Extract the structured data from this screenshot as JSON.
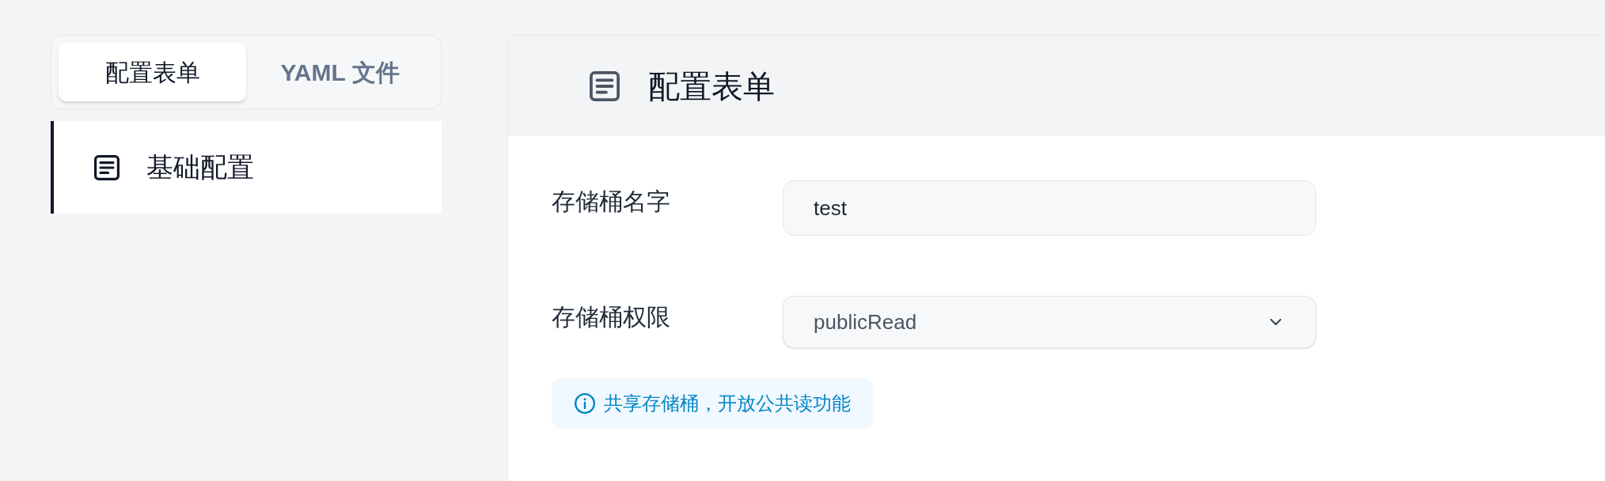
{
  "tabs": [
    {
      "label": "配置表单",
      "selected": true
    },
    {
      "label": "YAML 文件",
      "selected": false
    }
  ],
  "sidebar": {
    "items": [
      {
        "label": "基础配置",
        "selected": true
      }
    ]
  },
  "panel": {
    "title": "配置表单"
  },
  "form": {
    "fields": [
      {
        "kind": "text",
        "label": "存储桶名字",
        "value": "test"
      },
      {
        "kind": "select",
        "label": "存储桶权限",
        "value": "publicRead"
      }
    ],
    "notice": "共享存储桶，开放公共读功能"
  }
}
